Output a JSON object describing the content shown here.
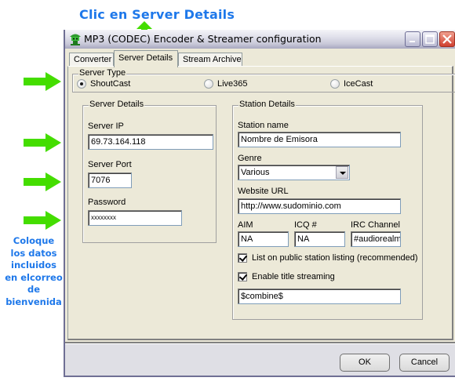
{
  "annotations": {
    "title": "Clic en Server Details",
    "note_lines": [
      "Coloque",
      "los datos",
      "incluidos",
      "en elcorreo",
      "de",
      "bienvenida"
    ],
    "arrow_color": "#44dd00",
    "text_color": "#1e78ea"
  },
  "window": {
    "title": "MP3 (CODEC) Encoder & Streamer configuration",
    "controls": {
      "minimize": "minimize",
      "maximize": "maximize",
      "close": "close"
    }
  },
  "tabs": [
    {
      "label": "Converter",
      "active": false
    },
    {
      "label": "Server Details",
      "active": true
    },
    {
      "label": "Stream Archive",
      "active": false
    }
  ],
  "server_type": {
    "legend": "Server Type",
    "options": [
      {
        "label": "ShoutCast",
        "selected": true
      },
      {
        "label": "Live365",
        "selected": false
      },
      {
        "label": "IceCast",
        "selected": false
      }
    ]
  },
  "server_details": {
    "legend": "Server Details",
    "ip_label": "Server IP",
    "ip_value": "69.73.164.118",
    "port_label": "Server Port",
    "port_value": "7076",
    "password_label": "Password",
    "password_value": "xxxxxxxx"
  },
  "station_details": {
    "legend": "Station Details",
    "name_label": "Station name",
    "name_value": "Nombre de Emisora",
    "genre_label": "Genre",
    "genre_value": "Various",
    "url_label": "Website URL",
    "url_value": "http://www.sudominio.com",
    "aim_label": "AIM",
    "aim_value": "NA",
    "icq_label": "ICQ #",
    "icq_value": "NA",
    "irc_label": "IRC Channel",
    "irc_value": "#audiorealm",
    "public_listing_label": "List on public station listing (recommended)",
    "public_listing_checked": true,
    "title_streaming_label": "Enable title streaming",
    "title_streaming_checked": true,
    "title_format_value": "$combine$"
  },
  "buttons": {
    "ok": "OK",
    "cancel": "Cancel"
  }
}
